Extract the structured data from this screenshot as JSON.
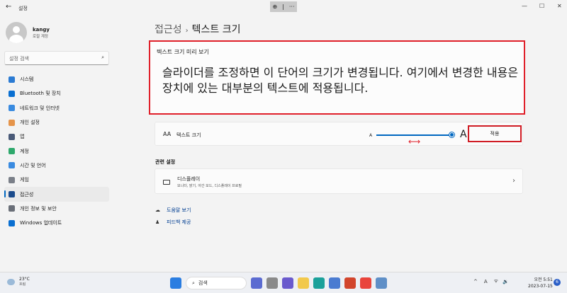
{
  "window": {
    "title": "설정",
    "back_glyph": "←",
    "zoom_glyph": "⊕",
    "zoom_divider": "|",
    "zoom_more": "···",
    "minimize": "—",
    "maximize": "☐",
    "close": "✕"
  },
  "profile": {
    "name": "kangy",
    "subtitle": "로컬 계정"
  },
  "search": {
    "placeholder": "설정 검색"
  },
  "sidebar": {
    "items": [
      {
        "label": "시스템",
        "icon": "system-icon",
        "color": "#2b7bd3"
      },
      {
        "label": "Bluetooth 및 장치",
        "icon": "bluetooth-icon",
        "color": "#0a6fd1"
      },
      {
        "label": "네트워크 및 인터넷",
        "icon": "network-icon",
        "color": "#3a8be0"
      },
      {
        "label": "개인 설정",
        "icon": "brush-icon",
        "color": "#e5944a"
      },
      {
        "label": "앱",
        "icon": "apps-icon",
        "color": "#4a5a78"
      },
      {
        "label": "계정",
        "icon": "account-icon",
        "color": "#2ea86c"
      },
      {
        "label": "시간 및 언어",
        "icon": "globe-clock-icon",
        "color": "#3a8be0"
      },
      {
        "label": "게임",
        "icon": "gaming-icon",
        "color": "#7a7f88"
      },
      {
        "label": "접근성",
        "icon": "accessibility-icon",
        "color": "#1b4b8c"
      },
      {
        "label": "개인 정보 및 보안",
        "icon": "shield-icon",
        "color": "#6a6f78"
      },
      {
        "label": "Windows 업데이트",
        "icon": "windows-update-icon",
        "color": "#0a6fd1"
      }
    ],
    "active_index": 8
  },
  "breadcrumb": {
    "parent": "접근성",
    "separator": "›",
    "current": "텍스트 크기"
  },
  "preview": {
    "label": "텍스트 크기 미리 보기",
    "text": "슬라이더를 조정하면 이 단어의 크기가 변경됩니다. 여기에서 변경한 내용은 장치에 있는 대부분의 텍스트에 적용됩니다."
  },
  "text_size": {
    "icon_text": "AA",
    "label": "텍스트 크기",
    "small_a": "A",
    "big_a": "A",
    "apply_label": "적용",
    "slider_value_fraction": 0.97
  },
  "annotation_arrow": "⟷",
  "related": {
    "heading": "관련 설정",
    "display_title": "디스플레이",
    "display_subtitle": "모니터, 밝기, 야간 모드, 디스플레이 프로필",
    "chevron": "›"
  },
  "links": [
    {
      "label": "도움말 보기",
      "icon": "help-icon",
      "glyph": "☁"
    },
    {
      "label": "피드백 제공",
      "icon": "feedback-icon",
      "glyph": "♟"
    }
  ],
  "taskbar": {
    "weather_temp": "23°C",
    "weather_desc": "흐림",
    "search_label": "검색",
    "search_glyph": "⌕",
    "tray_caret": "^",
    "tray_lang": "A",
    "tray_wifi": "ᯤ",
    "tray_volume": "🔉",
    "clock_time": "오전 5:51",
    "clock_date": "2023-07-15",
    "notification_count": "6"
  }
}
